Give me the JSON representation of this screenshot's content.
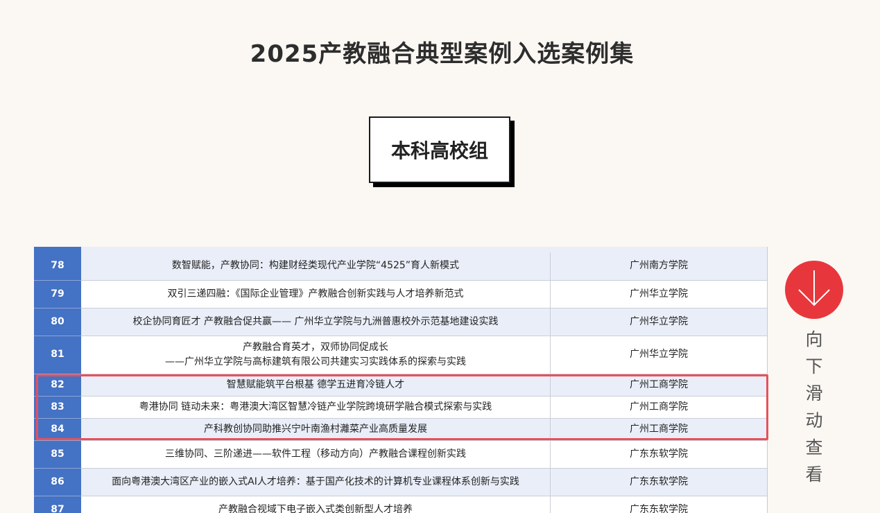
{
  "page": {
    "title": "2025产教融合典型案例入选案例集",
    "group_label": "本科高校组"
  },
  "table": {
    "rows": [
      {
        "num": "78",
        "project": [
          "数智赋能，产教协同：构建财经类现代产业学院“4525”育人新模式"
        ],
        "school": "广州南方学院",
        "alt": true
      },
      {
        "num": "79",
        "project": [
          "双引三递四融：《国际企业管理》产教融合创新实践与人才培养新范式"
        ],
        "school": "广州华立学院",
        "alt": false
      },
      {
        "num": "80",
        "project": [
          "校企协同育匠才 产教融合促共赢—— 广州华立学院与九洲普惠校外示范基地建设实践"
        ],
        "school": "广州华立学院",
        "alt": true
      },
      {
        "num": "81",
        "project": [
          "产教融合育英才，双师协同促成长",
          "——广州华立学院与高标建筑有限公司共建实习实践体系的探索与实践"
        ],
        "school": "广州华立学院",
        "alt": false
      },
      {
        "num": "82",
        "project": [
          "智慧赋能筑平台根基  德学五进育冷链人才"
        ],
        "school": "广州工商学院",
        "alt": true
      },
      {
        "num": "83",
        "project": [
          "粤港协同 链动未来：粤港澳大湾区智慧冷链产业学院跨境研学融合模式探索与实践"
        ],
        "school": "广州工商学院",
        "alt": false
      },
      {
        "num": "84",
        "project": [
          "产科教创协同助推兴宁叶南渔村灕菜产业高质量发展"
        ],
        "school": "广州工商学院",
        "alt": true
      },
      {
        "num": "85",
        "project": [
          "三维协同、三阶递进——软件工程（移动方向）产教融合课程创新实践"
        ],
        "school": "广东东软学院",
        "alt": false
      },
      {
        "num": "86",
        "project": [
          "面向粤港澳大湾区产业的嵌入式AI人才培养：基于国产化技术的计算机专业课程体系创新与实践"
        ],
        "school": "广东东软学院",
        "alt": true
      },
      {
        "num": "87",
        "project": [
          "产教融合视域下电子嵌入式类创新型人才培养"
        ],
        "school": "广东东软学院",
        "alt": false
      }
    ]
  },
  "scroll_hint": {
    "icon": "arrow-down-icon",
    "chars": [
      "向",
      "下",
      "滑",
      "动",
      "查",
      "看"
    ]
  },
  "colors": {
    "accent_red": "#e8373c",
    "table_blue": "#4472c4",
    "highlight": "#e8505b",
    "background": "#fbf7f3"
  }
}
